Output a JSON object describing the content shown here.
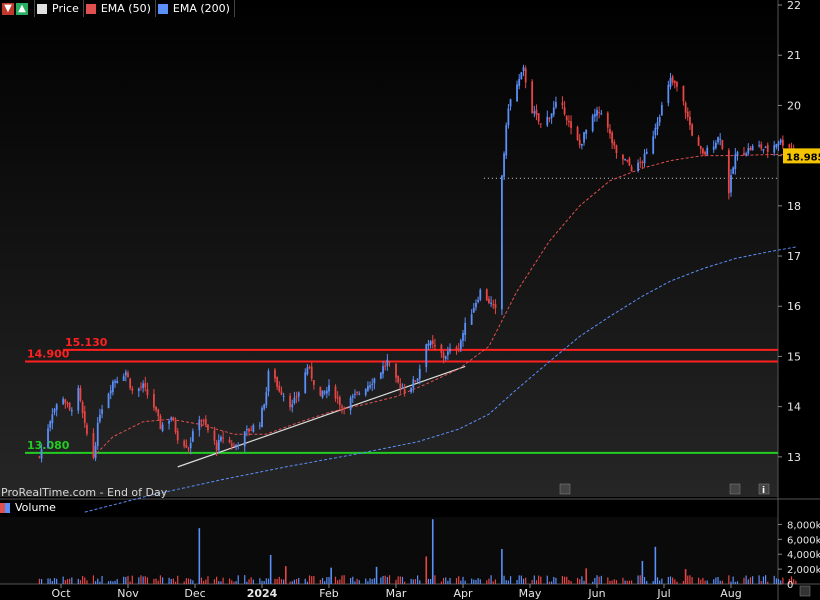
{
  "toolbar": {
    "down_icon": "red-down-arrow-icon",
    "up_icon": "green-up-arrow-icon",
    "price_label": "Price",
    "price_color": "#e0e0e0",
    "ema50_label": "EMA (50)",
    "ema50_color": "#e05050",
    "ema200_label": "EMA (200)",
    "ema200_color": "#5b8ff9"
  },
  "watermark": "ProRealTime.com - End of Day",
  "volume_panel": {
    "title": "Volume",
    "icon": "bar-chart-icon"
  },
  "chart_data": {
    "type": "candlestick",
    "x_labels": [
      "Oct",
      "Nov",
      "Dec",
      "2024",
      "Feb",
      "Mar",
      "Apr",
      "May",
      "Jun",
      "Jul",
      "Aug"
    ],
    "y_ticks": [
      13,
      14,
      15,
      16,
      17,
      18,
      19,
      20,
      21,
      22
    ],
    "ylim": [
      12.2,
      22.1
    ],
    "last_price": "18.985",
    "last_price_value": 18.985,
    "horizontal_levels": [
      {
        "label": "15.130",
        "value": 15.13,
        "color": "#ff2020"
      },
      {
        "label": "14.900",
        "value": 14.9,
        "color": "#ff2020"
      },
      {
        "label": "13.080",
        "value": 13.08,
        "color": "#22cc22"
      }
    ],
    "gap_support_value": 18.55,
    "trendline": {
      "from": {
        "date": "2023-11-24",
        "value": 12.8
      },
      "to": {
        "date": "2024-04-05",
        "value": 14.8
      },
      "color": "#dddddd"
    },
    "close_path": [
      [
        "2023-09-21",
        13.0
      ],
      [
        "2023-09-27",
        13.9
      ],
      [
        "2023-10-02",
        14.2
      ],
      [
        "2023-10-05",
        13.9
      ],
      [
        "2023-10-09",
        14.3
      ],
      [
        "2023-10-12",
        13.6
      ],
      [
        "2023-10-16",
        13.0
      ],
      [
        "2023-10-19",
        13.9
      ],
      [
        "2023-10-25",
        14.5
      ],
      [
        "2023-10-31",
        14.7
      ],
      [
        "2023-11-03",
        14.3
      ],
      [
        "2023-11-08",
        14.4
      ],
      [
        "2023-11-13",
        14.0
      ],
      [
        "2023-11-16",
        13.6
      ],
      [
        "2023-11-21",
        13.8
      ],
      [
        "2023-11-24",
        13.4
      ],
      [
        "2023-11-29",
        13.2
      ],
      [
        "2023-12-04",
        13.8
      ],
      [
        "2023-12-07",
        13.6
      ],
      [
        "2023-12-12",
        13.2
      ],
      [
        "2023-12-15",
        13.4
      ],
      [
        "2023-12-20",
        13.2
      ],
      [
        "2023-12-26",
        13.5
      ],
      [
        "2024-01-01",
        13.7
      ],
      [
        "2024-01-04",
        14.3
      ],
      [
        "2024-01-06",
        15.0
      ],
      [
        "2024-01-09",
        14.4
      ],
      [
        "2024-01-13",
        14.2
      ],
      [
        "2024-01-16",
        14.0
      ],
      [
        "2024-01-20",
        14.4
      ],
      [
        "2024-01-23",
        14.8
      ],
      [
        "2024-01-29",
        14.2
      ],
      [
        "2024-02-03",
        14.4
      ],
      [
        "2024-02-08",
        14.0
      ],
      [
        "2024-02-14",
        14.2
      ],
      [
        "2024-02-19",
        14.4
      ],
      [
        "2024-02-24",
        14.6
      ],
      [
        "2024-02-29",
        14.9
      ],
      [
        "2024-03-04",
        14.5
      ],
      [
        "2024-03-09",
        14.3
      ],
      [
        "2024-03-14",
        14.6
      ],
      [
        "2024-03-18",
        15.3
      ],
      [
        "2024-03-21",
        15.2
      ],
      [
        "2024-03-26",
        15.0
      ],
      [
        "2024-03-29",
        15.1
      ],
      [
        "2024-04-02",
        15.2
      ],
      [
        "2024-04-05",
        15.6
      ],
      [
        "2024-04-08",
        15.9
      ],
      [
        "2024-04-12",
        16.3
      ],
      [
        "2024-04-16",
        16.1
      ],
      [
        "2024-04-19",
        15.9
      ],
      [
        "2024-04-22",
        18.6
      ],
      [
        "2024-04-25",
        20.0
      ],
      [
        "2024-04-29",
        20.4
      ],
      [
        "2024-05-02",
        20.7
      ],
      [
        "2024-05-06",
        19.9
      ],
      [
        "2024-05-10",
        19.6
      ],
      [
        "2024-05-14",
        19.8
      ],
      [
        "2024-05-17",
        20.0
      ],
      [
        "2024-05-21",
        19.9
      ],
      [
        "2024-05-24",
        19.5
      ],
      [
        "2024-05-28",
        19.2
      ],
      [
        "2024-05-31",
        19.5
      ],
      [
        "2024-06-04",
        19.8
      ],
      [
        "2024-06-07",
        19.9
      ],
      [
        "2024-06-11",
        19.4
      ],
      [
        "2024-06-14",
        19.0
      ],
      [
        "2024-06-18",
        18.9
      ],
      [
        "2024-06-22",
        18.7
      ],
      [
        "2024-06-26",
        18.9
      ],
      [
        "2024-06-29",
        19.1
      ],
      [
        "2024-07-02",
        19.6
      ],
      [
        "2024-07-06",
        20.1
      ],
      [
        "2024-07-09",
        20.5
      ],
      [
        "2024-07-13",
        20.3
      ],
      [
        "2024-07-16",
        19.9
      ],
      [
        "2024-07-20",
        19.3
      ],
      [
        "2024-07-24",
        19.0
      ],
      [
        "2024-07-28",
        19.2
      ],
      [
        "2024-08-01",
        19.4
      ],
      [
        "2024-08-05",
        18.3
      ],
      [
        "2024-08-08",
        19.0
      ],
      [
        "2024-08-13",
        19.1
      ],
      [
        "2024-08-18",
        19.2
      ],
      [
        "2024-08-23",
        19.1
      ],
      [
        "2024-08-28",
        19.3
      ],
      [
        "2024-09-02",
        19.2
      ],
      [
        "2024-09-05",
        18.985
      ]
    ],
    "ema50_path": [
      [
        "2023-10-16",
        13.0
      ],
      [
        "2023-10-25",
        13.4
      ],
      [
        "2023-11-08",
        13.7
      ],
      [
        "2023-11-21",
        13.75
      ],
      [
        "2023-12-04",
        13.65
      ],
      [
        "2023-12-20",
        13.45
      ],
      [
        "2024-01-04",
        13.45
      ],
      [
        "2024-01-20",
        13.7
      ],
      [
        "2024-02-03",
        13.9
      ],
      [
        "2024-02-19",
        14.05
      ],
      [
        "2024-03-04",
        14.2
      ],
      [
        "2024-03-18",
        14.45
      ],
      [
        "2024-04-02",
        14.75
      ],
      [
        "2024-04-16",
        15.2
      ],
      [
        "2024-04-29",
        16.3
      ],
      [
        "2024-05-14",
        17.3
      ],
      [
        "2024-05-28",
        18.0
      ],
      [
        "2024-06-11",
        18.5
      ],
      [
        "2024-06-26",
        18.75
      ],
      [
        "2024-07-09",
        18.9
      ],
      [
        "2024-07-24",
        19.0
      ],
      [
        "2024-08-08",
        19.0
      ],
      [
        "2024-08-23",
        19.02
      ],
      [
        "2024-09-05",
        19.03
      ]
    ],
    "ema200_path": [
      [
        "2023-10-12",
        11.9
      ],
      [
        "2023-11-13",
        12.25
      ],
      [
        "2023-12-15",
        12.55
      ],
      [
        "2024-01-13",
        12.8
      ],
      [
        "2024-02-14",
        13.05
      ],
      [
        "2024-03-14",
        13.3
      ],
      [
        "2024-04-02",
        13.55
      ],
      [
        "2024-04-16",
        13.85
      ],
      [
        "2024-04-29",
        14.35
      ],
      [
        "2024-05-14",
        14.9
      ],
      [
        "2024-05-28",
        15.4
      ],
      [
        "2024-06-11",
        15.8
      ],
      [
        "2024-06-26",
        16.2
      ],
      [
        "2024-07-09",
        16.5
      ],
      [
        "2024-07-24",
        16.75
      ],
      [
        "2024-08-08",
        16.95
      ],
      [
        "2024-08-23",
        17.08
      ],
      [
        "2024-09-05",
        17.18
      ]
    ],
    "volume": {
      "y_ticks": [
        "8,000k",
        "6,000k",
        "4,000k",
        "2,000k",
        "0"
      ],
      "ylim": [
        0,
        9000
      ],
      "spikes": [
        {
          "date": "2023-12-04",
          "value": 7500
        },
        {
          "date": "2024-01-06",
          "value": 3900
        },
        {
          "date": "2024-01-13",
          "value": 2400
        },
        {
          "date": "2024-02-03",
          "value": 2200
        },
        {
          "date": "2024-02-24",
          "value": 2300
        },
        {
          "date": "2024-03-18",
          "value": 3700
        },
        {
          "date": "2024-03-21",
          "value": 8700
        },
        {
          "date": "2024-04-22",
          "value": 4700
        },
        {
          "date": "2024-05-31",
          "value": 2100
        },
        {
          "date": "2024-06-26",
          "value": 3100
        },
        {
          "date": "2024-07-02",
          "value": 5000
        },
        {
          "date": "2024-07-16",
          "value": 2000
        }
      ]
    }
  }
}
